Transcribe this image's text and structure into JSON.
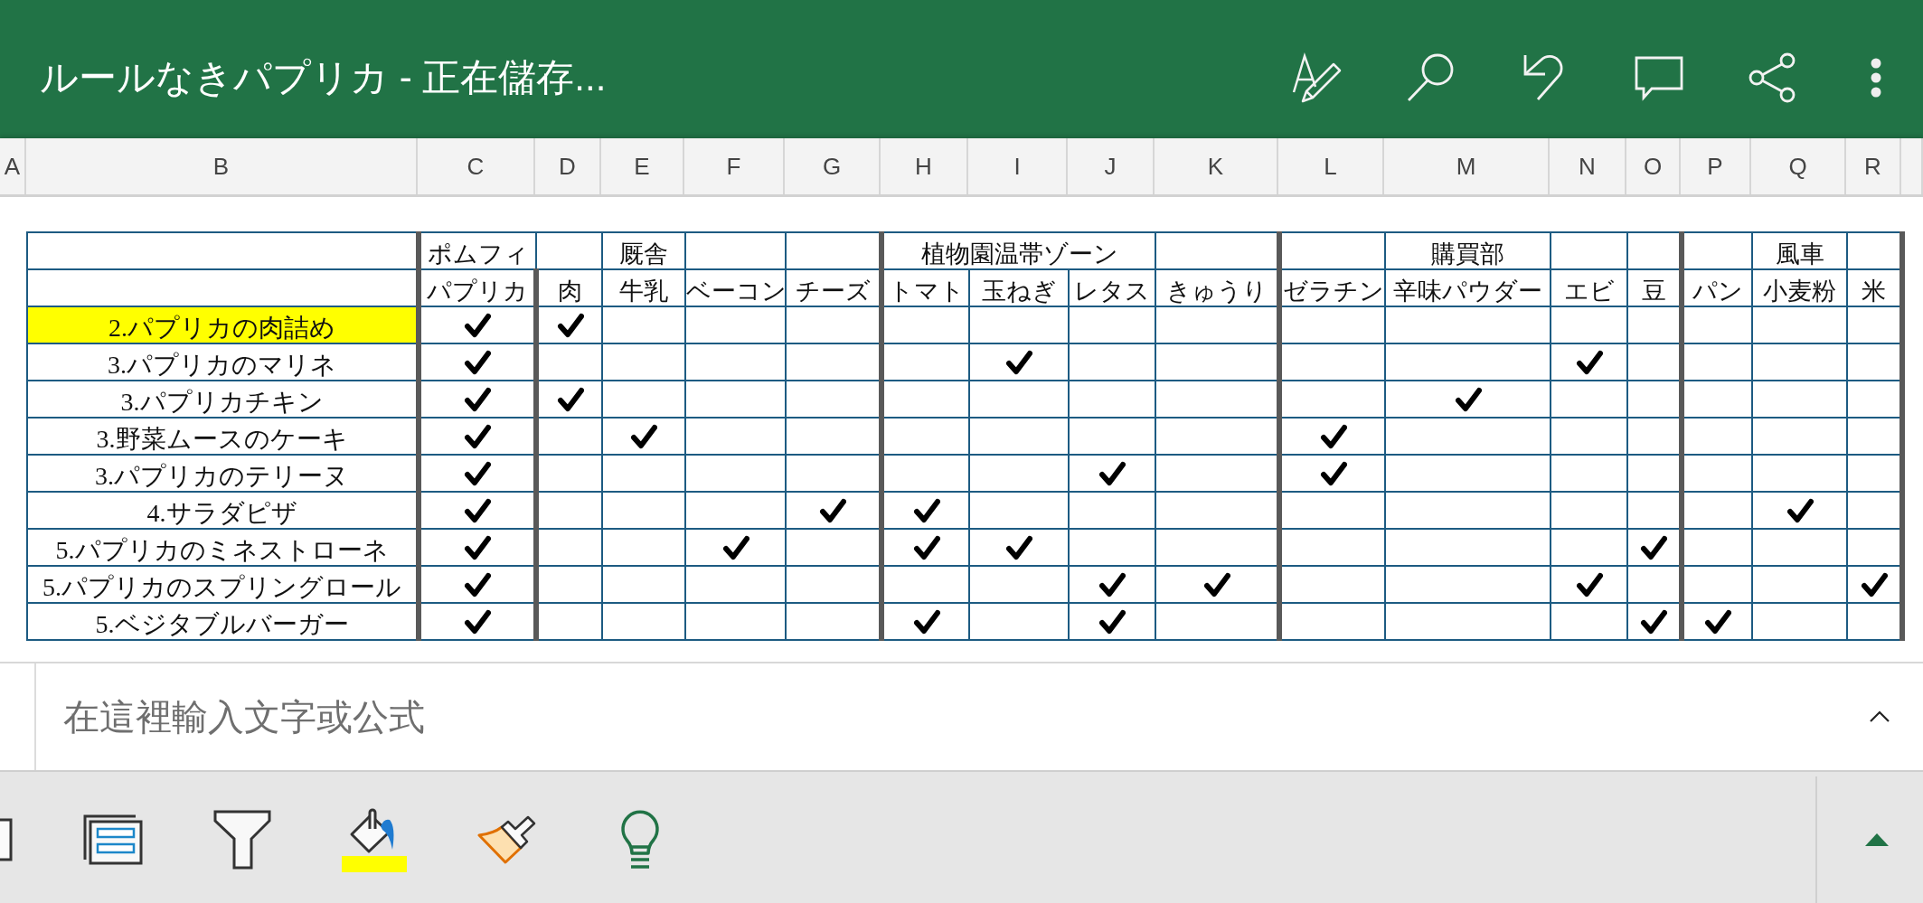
{
  "window": {
    "title": "ルールなきパプリカ - 正在儲存..."
  },
  "column_headers": [
    "A",
    "B",
    "C",
    "D",
    "E",
    "F",
    "G",
    "H",
    "I",
    "J",
    "K",
    "L",
    "M",
    "N",
    "O",
    "P",
    "Q",
    "R"
  ],
  "table": {
    "header_groups": [
      {
        "label": "ポムフィ",
        "columns": [
          {
            "label": "パプリカ"
          }
        ]
      },
      {
        "columns": [
          {
            "label": "肉"
          }
        ]
      },
      {
        "label": "厩舎",
        "columns": [
          {
            "label": "牛乳"
          }
        ]
      },
      {
        "columns": [
          {
            "label": "ベーコン"
          }
        ]
      },
      {
        "columns": [
          {
            "label": "チーズ"
          }
        ]
      },
      {
        "label": "植物園温帯ゾーン",
        "columns": [
          {
            "label": "トマト"
          },
          {
            "label": "玉ねぎ"
          },
          {
            "label": "レタス"
          }
        ]
      },
      {
        "columns": [
          {
            "label": "きゅうり"
          }
        ]
      },
      {
        "columns": [
          {
            "label": "ゼラチン"
          }
        ]
      },
      {
        "label": "購買部",
        "columns": [
          {
            "label": "辛味パウダー"
          }
        ]
      },
      {
        "columns": [
          {
            "label": "エビ"
          }
        ]
      },
      {
        "columns": [
          {
            "label": "豆"
          }
        ]
      },
      {
        "columns": [
          {
            "label": "パン"
          }
        ]
      },
      {
        "label": "風車",
        "columns": [
          {
            "label": "小麦粉"
          }
        ]
      },
      {
        "columns": [
          {
            "label": "米"
          }
        ]
      }
    ],
    "rows": [
      {
        "label": "2.パプリカの肉詰め",
        "highlighted": true,
        "checks": [
          true,
          true,
          false,
          false,
          false,
          false,
          false,
          false,
          false,
          false,
          false,
          false,
          false,
          false,
          false,
          false
        ]
      },
      {
        "label": "3.パプリカのマリネ",
        "highlighted": false,
        "checks": [
          true,
          false,
          false,
          false,
          false,
          false,
          true,
          false,
          false,
          false,
          false,
          true,
          false,
          false,
          false,
          false
        ]
      },
      {
        "label": "3.パプリカチキン",
        "highlighted": false,
        "checks": [
          true,
          true,
          false,
          false,
          false,
          false,
          false,
          false,
          false,
          false,
          true,
          false,
          false,
          false,
          false,
          false
        ]
      },
      {
        "label": "3.野菜ムースのケーキ",
        "highlighted": false,
        "checks": [
          true,
          false,
          true,
          false,
          false,
          false,
          false,
          false,
          false,
          true,
          false,
          false,
          false,
          false,
          false,
          false
        ]
      },
      {
        "label": "3.パプリカのテリーヌ",
        "highlighted": false,
        "checks": [
          true,
          false,
          false,
          false,
          false,
          false,
          false,
          true,
          false,
          true,
          false,
          false,
          false,
          false,
          false,
          false
        ]
      },
      {
        "label": "4.サラダピザ",
        "highlighted": false,
        "checks": [
          true,
          false,
          false,
          false,
          true,
          true,
          false,
          false,
          false,
          false,
          false,
          false,
          false,
          false,
          true,
          false
        ]
      },
      {
        "label": "5.パプリカのミネストローネ",
        "highlighted": false,
        "checks": [
          true,
          false,
          false,
          true,
          false,
          true,
          true,
          false,
          false,
          false,
          false,
          false,
          true,
          false,
          false,
          false
        ]
      },
      {
        "label": "5.パプリカのスプリングロール",
        "highlighted": false,
        "checks": [
          true,
          false,
          false,
          false,
          false,
          false,
          false,
          true,
          true,
          false,
          false,
          true,
          false,
          false,
          false,
          true
        ]
      },
      {
        "label": "5.ベジタブルバーガー",
        "highlighted": false,
        "checks": [
          true,
          false,
          false,
          false,
          false,
          true,
          false,
          true,
          false,
          false,
          false,
          false,
          true,
          true,
          false,
          false
        ]
      }
    ]
  },
  "formula_bar": {
    "placeholder": "在這裡輸入文字或公式"
  }
}
